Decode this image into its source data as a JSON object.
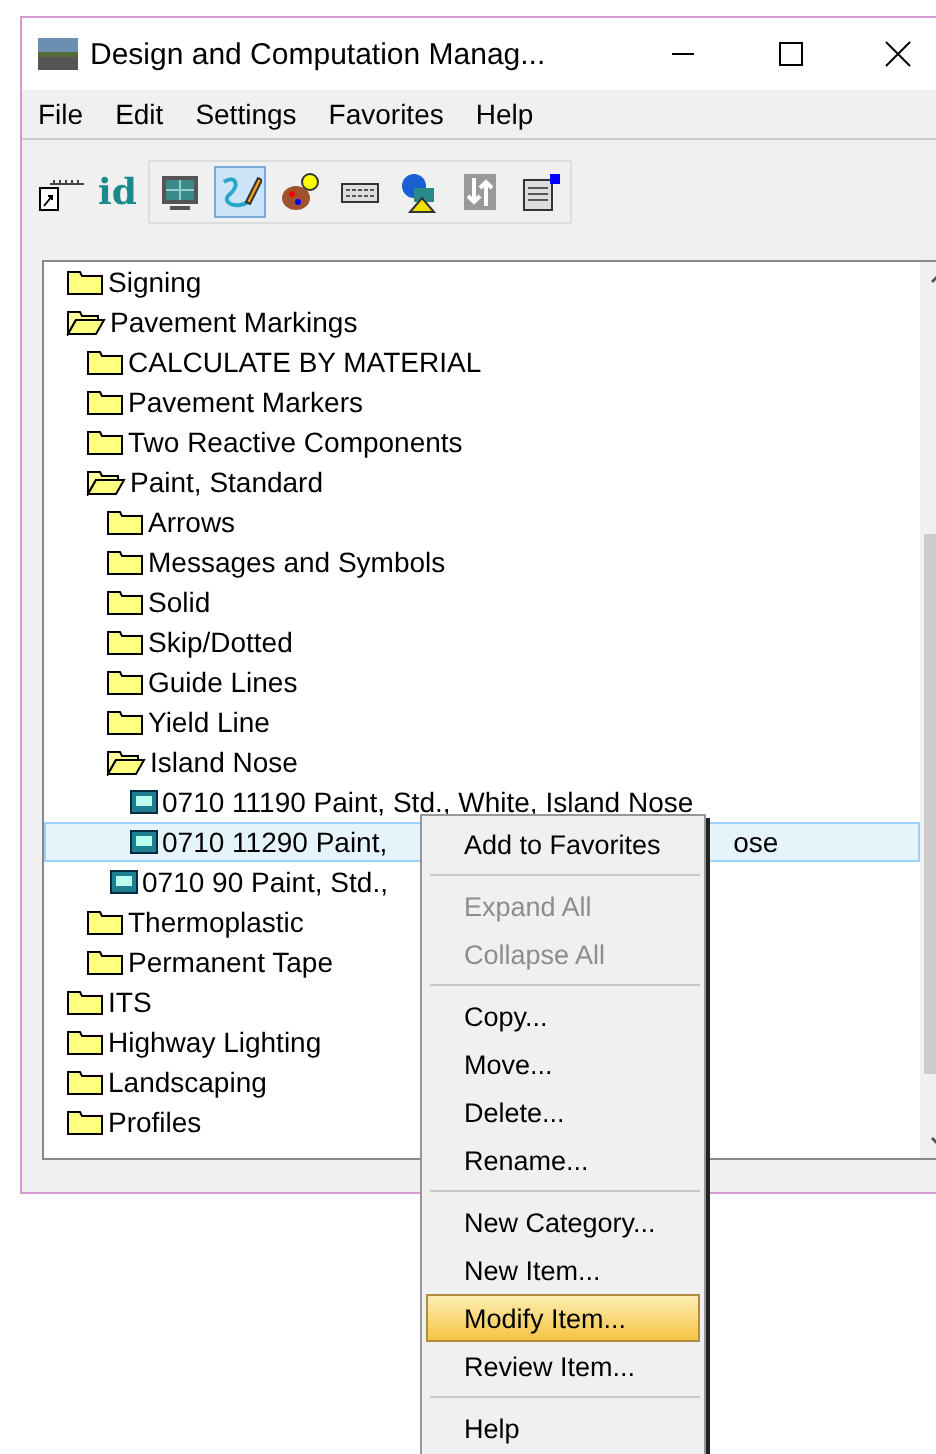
{
  "window": {
    "title": "Design and Computation Manag..."
  },
  "menu_bar": [
    "File",
    "Edit",
    "Settings",
    "Favorites",
    "Help"
  ],
  "toolbar": {
    "id_label": "id",
    "buttons": [
      {
        "kind": "monitor",
        "selected": false
      },
      {
        "kind": "pen",
        "selected": true
      },
      {
        "kind": "palette",
        "selected": false
      },
      {
        "kind": "keyboard",
        "selected": false
      },
      {
        "kind": "shapes",
        "selected": false
      },
      {
        "kind": "sort",
        "selected": false
      },
      {
        "kind": "clipboard",
        "selected": false
      }
    ]
  },
  "tree": [
    {
      "label": "Signing",
      "kind": "folder",
      "expanded": false,
      "selected": false
    },
    {
      "label": "Pavement Markings",
      "kind": "folder",
      "expanded": true,
      "selected": false,
      "children": [
        {
          "label": "CALCULATE BY MATERIAL",
          "kind": "folder",
          "expanded": false,
          "selected": false
        },
        {
          "label": "Pavement Markers",
          "kind": "folder",
          "expanded": false,
          "selected": false
        },
        {
          "label": "Two Reactive Components",
          "kind": "folder",
          "expanded": false,
          "selected": false
        },
        {
          "label": "Paint, Standard",
          "kind": "folder",
          "expanded": true,
          "selected": false,
          "children": [
            {
              "label": "Arrows",
              "kind": "folder",
              "expanded": false,
              "selected": false
            },
            {
              "label": "Messages and Symbols",
              "kind": "folder",
              "expanded": false,
              "selected": false
            },
            {
              "label": "Solid",
              "kind": "folder",
              "expanded": false,
              "selected": false
            },
            {
              "label": "Skip/Dotted",
              "kind": "folder",
              "expanded": false,
              "selected": false
            },
            {
              "label": "Guide Lines",
              "kind": "folder",
              "expanded": false,
              "selected": false
            },
            {
              "label": "Yield Line",
              "kind": "folder",
              "expanded": false,
              "selected": false
            },
            {
              "label": "Island Nose",
              "kind": "folder",
              "expanded": true,
              "selected": false,
              "children": [
                {
                  "label": "0710 11190 Paint, Std., White, Island Nose",
                  "kind": "item",
                  "selected": false
                },
                {
                  "label": "0710 11290 Paint,",
                  "tail": "ose",
                  "kind": "item",
                  "selected": true
                }
              ]
            },
            {
              "label": "0710 90 Paint, Std.,",
              "kind": "item",
              "selected": false
            }
          ]
        },
        {
          "label": "Thermoplastic",
          "kind": "folder",
          "expanded": false,
          "selected": false
        },
        {
          "label": "Permanent Tape",
          "kind": "folder",
          "expanded": false,
          "selected": false
        }
      ]
    },
    {
      "label": "ITS",
      "kind": "folder",
      "expanded": false,
      "selected": false
    },
    {
      "label": "Highway Lighting",
      "kind": "folder",
      "expanded": false,
      "selected": false
    },
    {
      "label": "Landscaping",
      "kind": "folder",
      "expanded": false,
      "selected": false
    },
    {
      "label": "Profiles",
      "kind": "folder",
      "expanded": false,
      "selected": false
    }
  ],
  "context_menu": [
    {
      "kind": "item",
      "label": "Add to Favorites",
      "disabled": false,
      "selected": false
    },
    {
      "kind": "separator"
    },
    {
      "kind": "item",
      "label": "Expand All",
      "disabled": true,
      "selected": false
    },
    {
      "kind": "item",
      "label": "Collapse All",
      "disabled": true,
      "selected": false
    },
    {
      "kind": "separator"
    },
    {
      "kind": "item",
      "label": "Copy...",
      "disabled": false,
      "selected": false
    },
    {
      "kind": "item",
      "label": "Move...",
      "disabled": false,
      "selected": false
    },
    {
      "kind": "item",
      "label": "Delete...",
      "disabled": false,
      "selected": false
    },
    {
      "kind": "item",
      "label": "Rename...",
      "disabled": false,
      "selected": false
    },
    {
      "kind": "separator"
    },
    {
      "kind": "item",
      "label": "New Category...",
      "disabled": false,
      "selected": false
    },
    {
      "kind": "item",
      "label": "New Item...",
      "disabled": false,
      "selected": false
    },
    {
      "kind": "item",
      "label": "Modify Item...",
      "disabled": false,
      "selected": true
    },
    {
      "kind": "item",
      "label": "Review Item...",
      "disabled": false,
      "selected": false
    },
    {
      "kind": "separator"
    },
    {
      "kind": "item",
      "label": "Help",
      "disabled": false,
      "selected": false
    }
  ]
}
